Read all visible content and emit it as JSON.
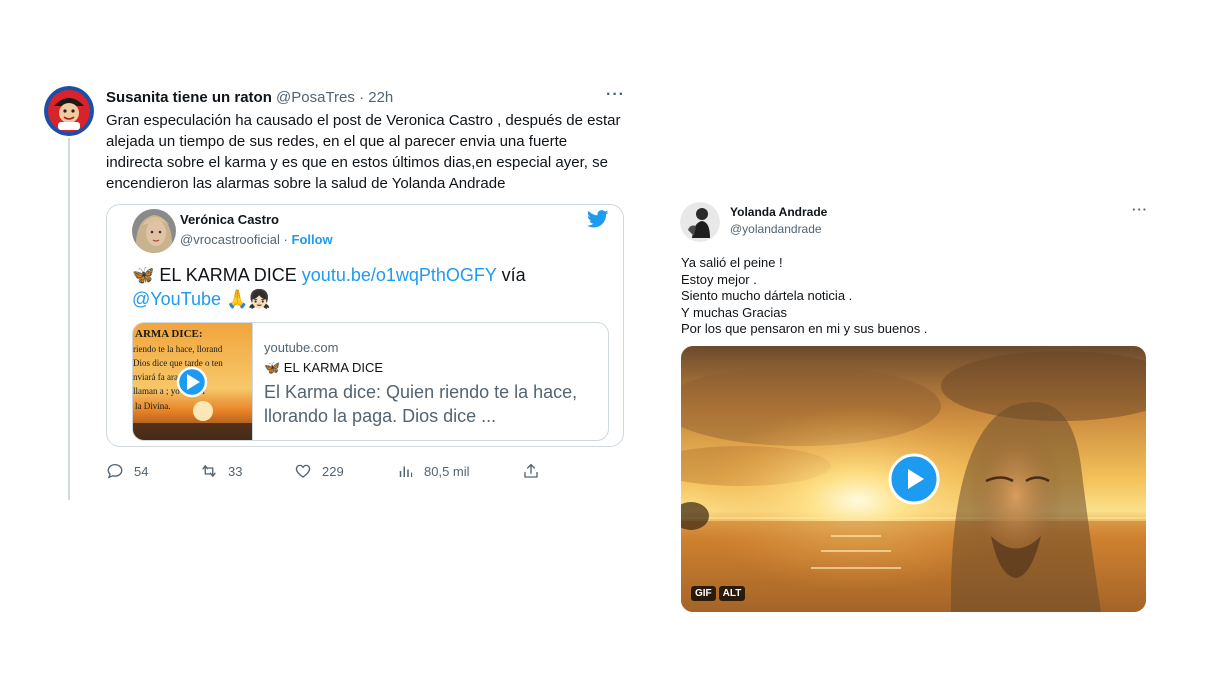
{
  "left_tweet": {
    "author_name": "Susanita tiene un raton",
    "author_handle": "@PosaTres",
    "separator": "·",
    "time": "22h",
    "more": "···",
    "body": "Gran especulación ha causado el post de Veronica Castro , después de estar alejada un tiempo de sus redes, en el que al parecer envia una fuerte indirecta sobre el karma y es que en estos últimos dias,en especial ayer, se encendieron las alarmas sobre la salud de Yolanda Andrade",
    "quote": {
      "author_name": "Verónica Castro",
      "author_handle": "@vrocastrooficial",
      "separator": "·",
      "follow_label": "Follow",
      "text_prefix": "🦋 EL KARMA DICE ",
      "text_link": "youtu.be/o1wqPthOGFY",
      "text_mid": " vía",
      "text_mention": "@YouTube",
      "text_emoji": " 🙏👧🏻",
      "link_card": {
        "domain": "youtube.com",
        "title_small": "🦋 EL KARMA DICE",
        "title_big": "El Karma dice: Quien riendo te la hace, llorando la paga. Dios dice ...",
        "thumb_lines": [
          "ARMA DICE:",
          "riendo te la hace, llorand",
          "Dios dice que tarde o ten",
          "nviará fa   ara ajusta",
          "llaman a   ; yo lo llan",
          "la Divina."
        ]
      }
    },
    "actions": {
      "replies": "54",
      "retweets": "33",
      "likes": "229",
      "views": "80,5 mil"
    }
  },
  "right_tweet": {
    "author_name": "Yolanda Andrade",
    "author_handle": "@yolandandrade",
    "more": "···",
    "lines": [
      "Ya salió el peine !",
      "Estoy mejor .",
      "Siento mucho dártela noticia .",
      "Y muchas Gracias",
      "Por los que pensaron en mi y sus buenos ."
    ],
    "media_badges": [
      "GIF",
      "ALT"
    ]
  },
  "colors": {
    "accent": "#1d9bf0",
    "text_secondary": "#536471",
    "border": "#cfd9de"
  }
}
